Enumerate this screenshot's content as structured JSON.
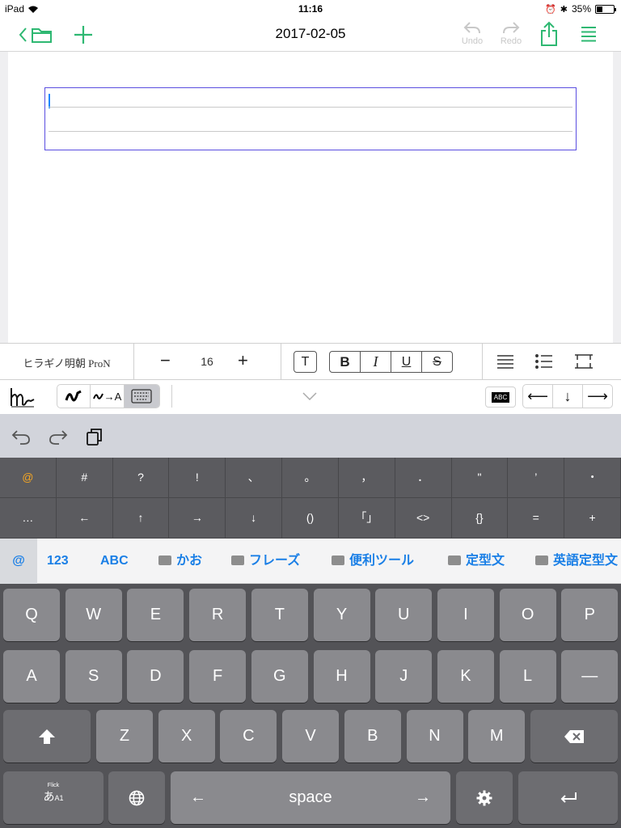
{
  "status": {
    "device": "iPad",
    "time": "11:16",
    "battery": "35%",
    "battery_level": 0.35
  },
  "nav": {
    "title": "2017-02-05",
    "undo": "Undo",
    "redo": "Redo",
    "accent": "#2eb872"
  },
  "format": {
    "font": "ヒラギノ明朝 ProN",
    "minus": "−",
    "size": "16",
    "plus": "+",
    "text_icon": "T",
    "bold": "B",
    "italic": "I",
    "underline": "U",
    "strike": "S"
  },
  "tools": {
    "convert_label": "→A",
    "icon_box": "ABC",
    "left": "⟵",
    "down": "↓",
    "right": "⟶"
  },
  "symbols": {
    "row1": [
      "@",
      "#",
      "?",
      "!",
      "、",
      "。",
      "，",
      "．",
      "\"",
      "’",
      "・"
    ],
    "row2": [
      "…",
      "←",
      "↑",
      "→",
      "↓",
      "()",
      "「」",
      "<>",
      "{}",
      "=",
      "+"
    ]
  },
  "categories": [
    {
      "label": "@",
      "folder": false
    },
    {
      "label": "123",
      "folder": false
    },
    {
      "label": "ABC",
      "folder": false
    },
    {
      "label": "かお",
      "folder": true
    },
    {
      "label": "フレーズ",
      "folder": true
    },
    {
      "label": "便利ツール",
      "folder": true
    },
    {
      "label": "定型文",
      "folder": true
    },
    {
      "label": "英語定型文",
      "folder": true
    }
  ],
  "keyboard": {
    "row1": [
      "Q",
      "W",
      "E",
      "R",
      "T",
      "Y",
      "U",
      "I",
      "O",
      "P"
    ],
    "row2": [
      "A",
      "S",
      "D",
      "F",
      "G",
      "H",
      "J",
      "K",
      "L",
      "—"
    ],
    "row3": [
      "Z",
      "X",
      "C",
      "V",
      "B",
      "N",
      "M"
    ],
    "flick": "Flick",
    "kana": "あ",
    "kana_sub": "A1",
    "space": "space",
    "left": "←",
    "right": "→"
  }
}
